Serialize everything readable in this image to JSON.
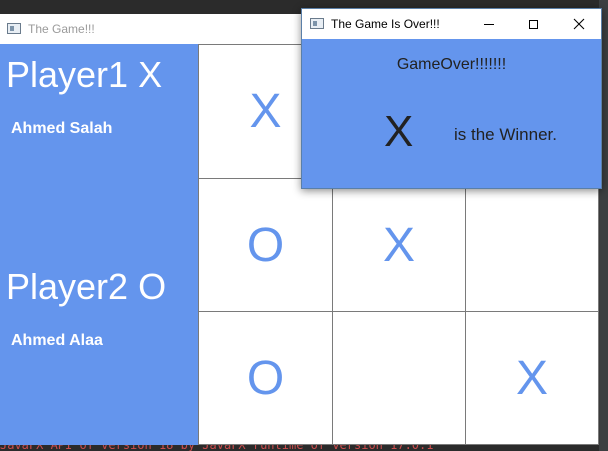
{
  "background": {
    "console_text": "JavaFX API of version 18 by JavaFX runtime of version 17.0.1",
    "console_color": "#c94c4c"
  },
  "game_window": {
    "title": "The Game!!!",
    "players": {
      "player1_label": "Player1 X",
      "player1_name": "Ahmed Salah",
      "player2_label": "Player2 O",
      "player2_name": "Ahmed Alaa"
    },
    "board": {
      "cells": [
        "X",
        "",
        "",
        "O",
        "X",
        "",
        "O",
        "",
        "X"
      ]
    },
    "accent_color": "#6495ed"
  },
  "dialog": {
    "title": "The Game Is Over!!!",
    "message": "GameOver!!!!!!!",
    "winner_symbol": "X",
    "winner_text": "is the Winner."
  }
}
